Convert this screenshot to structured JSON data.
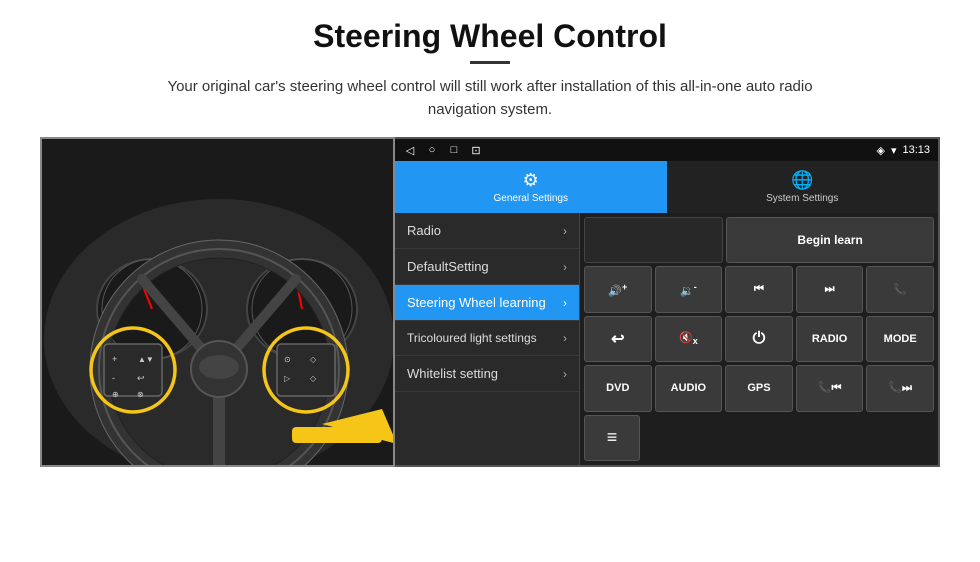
{
  "page": {
    "title": "Steering Wheel Control",
    "subtitle": "Your original car's steering wheel control will still work after installation of this all-in-one auto radio navigation system."
  },
  "status_bar": {
    "time": "13:13",
    "icons": [
      "◁",
      "○",
      "□",
      "⊡"
    ]
  },
  "tabs": [
    {
      "id": "general",
      "label": "General Settings",
      "icon": "⚙",
      "active": true
    },
    {
      "id": "system",
      "label": "System Settings",
      "icon": "🌐",
      "active": false
    }
  ],
  "menu_items": [
    {
      "id": "radio",
      "label": "Radio",
      "active": false
    },
    {
      "id": "default",
      "label": "DefaultSetting",
      "active": false
    },
    {
      "id": "steering",
      "label": "Steering Wheel learning",
      "active": true
    },
    {
      "id": "tricoloured",
      "label": "Tricoloured light settings",
      "active": false
    },
    {
      "id": "whitelist",
      "label": "Whitelist setting",
      "active": false
    }
  ],
  "control_buttons": {
    "row0": [
      {
        "id": "empty",
        "label": "",
        "type": "empty"
      },
      {
        "id": "begin-learn",
        "label": "Begin learn",
        "type": "begin-learn"
      }
    ],
    "row1": [
      {
        "id": "vol-up",
        "label": "🔊+",
        "type": "icon"
      },
      {
        "id": "vol-down",
        "label": "🔉-",
        "type": "icon"
      },
      {
        "id": "prev-track",
        "label": "⏮",
        "type": "icon"
      },
      {
        "id": "next-track",
        "label": "⏭",
        "type": "icon"
      },
      {
        "id": "phone",
        "label": "📞",
        "type": "icon"
      }
    ],
    "row2": [
      {
        "id": "hang-up",
        "label": "↩",
        "type": "icon"
      },
      {
        "id": "mute",
        "label": "🔇x",
        "type": "icon"
      },
      {
        "id": "power",
        "label": "⏻",
        "type": "icon"
      },
      {
        "id": "radio-btn",
        "label": "RADIO",
        "type": "text"
      },
      {
        "id": "mode",
        "label": "MODE",
        "type": "text"
      }
    ],
    "row3": [
      {
        "id": "dvd",
        "label": "DVD",
        "type": "text"
      },
      {
        "id": "audio",
        "label": "AUDIO",
        "type": "text"
      },
      {
        "id": "gps",
        "label": "GPS",
        "type": "text"
      },
      {
        "id": "tel-prev",
        "label": "📞⏮",
        "type": "icon"
      },
      {
        "id": "tel-next",
        "label": "📞⏭",
        "type": "icon"
      }
    ],
    "row4": [
      {
        "id": "list-icon",
        "label": "≡",
        "type": "icon"
      }
    ]
  }
}
